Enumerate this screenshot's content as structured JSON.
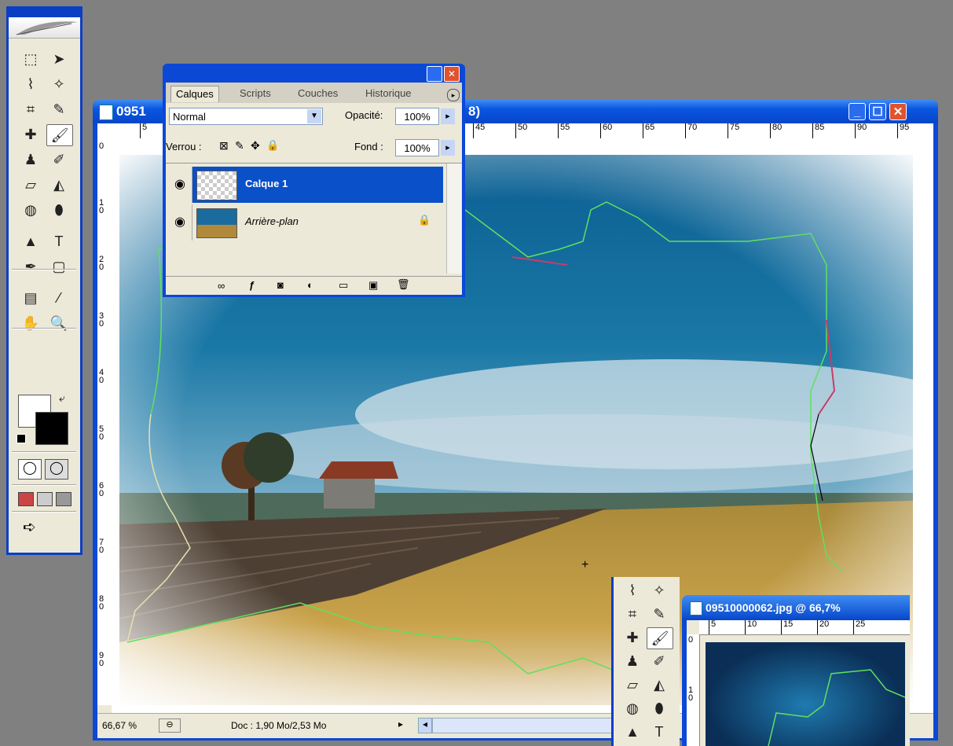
{
  "toolbox": {
    "tools": [
      {
        "name": "marquee",
        "glyph": "⬚"
      },
      {
        "name": "move",
        "glyph": "➤"
      },
      {
        "name": "lasso",
        "glyph": "⌇"
      },
      {
        "name": "magic-wand",
        "glyph": "✧"
      },
      {
        "name": "crop",
        "glyph": "⌗"
      },
      {
        "name": "slice",
        "glyph": "✎"
      },
      {
        "name": "healing-brush",
        "glyph": "✚"
      },
      {
        "name": "brush",
        "glyph": "🖌"
      },
      {
        "name": "clone-stamp",
        "glyph": "♟"
      },
      {
        "name": "history-brush",
        "glyph": "✐"
      },
      {
        "name": "eraser",
        "glyph": "▱"
      },
      {
        "name": "paint-bucket",
        "glyph": "◭"
      },
      {
        "name": "blur",
        "glyph": "◍"
      },
      {
        "name": "dodge",
        "glyph": "⬮"
      },
      {
        "name": "path-select",
        "glyph": "▲"
      },
      {
        "name": "type",
        "glyph": "T"
      },
      {
        "name": "pen",
        "glyph": "✒"
      },
      {
        "name": "shape",
        "glyph": "▢"
      },
      {
        "name": "notes",
        "glyph": "▤"
      },
      {
        "name": "eyedropper",
        "glyph": "⁄"
      },
      {
        "name": "hand",
        "glyph": "✋"
      },
      {
        "name": "zoom",
        "glyph": "🔍"
      }
    ]
  },
  "doc": {
    "title": "0951",
    "title_suffix": "8)",
    "ruler_top": [
      "5",
      "45",
      "50",
      "55",
      "60",
      "65",
      "70",
      "75",
      "80",
      "85",
      "90",
      "95"
    ],
    "ruler_left": [
      "0",
      "1 0",
      "2 0",
      "3 0",
      "4 0",
      "5 0",
      "6 0",
      "7 0",
      "8 0",
      "9 0"
    ],
    "zoom": "66,67 %",
    "doc_info": "Doc : 1,90 Mo/2,53 Mo"
  },
  "layers_panel": {
    "tabs": [
      "Calques",
      "Scripts",
      "Couches",
      "Historique"
    ],
    "blend_mode": "Normal",
    "opacity_label": "Opacité:",
    "opacity_value": "100%",
    "lock_label": "Verrou :",
    "fill_label": "Fond :",
    "fill_value": "100%",
    "layers": [
      {
        "name": "Calque 1",
        "selected": true
      },
      {
        "name": "Arrière-plan",
        "selected": false
      }
    ]
  },
  "second_window": {
    "title": "09510000062.jpg @ 66,7%",
    "ruler_top": [
      "5",
      "10",
      "15",
      "20",
      "25"
    ],
    "ruler_left": [
      "0",
      "1 0"
    ]
  },
  "colors": {
    "xp_blue": "#0b48d6",
    "selected_layer": "#0a50c8",
    "panel_bg": "#ece9d8"
  }
}
